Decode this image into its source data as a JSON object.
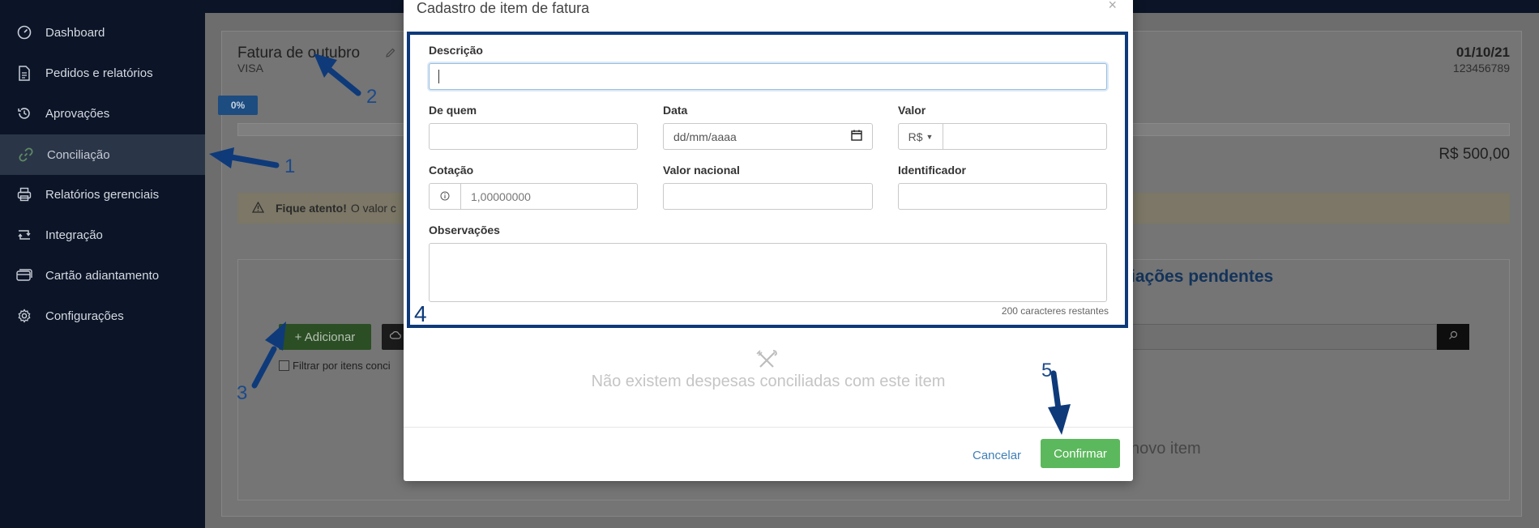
{
  "sidebar": {
    "items": [
      {
        "label": "Dashboard",
        "icon": "dashboard-icon"
      },
      {
        "label": "Pedidos e relatórios",
        "icon": "document-icon"
      },
      {
        "label": "Aprovações",
        "icon": "history-icon"
      },
      {
        "label": "Conciliação",
        "icon": "link-icon",
        "active": true
      },
      {
        "label": "Relatórios gerenciais",
        "icon": "printer-icon"
      },
      {
        "label": "Integração",
        "icon": "sync-icon"
      },
      {
        "label": "Cartão adiantamento",
        "icon": "card-icon"
      },
      {
        "label": "Configurações",
        "icon": "gear-icon"
      }
    ]
  },
  "invoice": {
    "title": "Fatura de outubro",
    "subtitle": "VISA",
    "date": "01/10/21",
    "number": "123456789",
    "progress_label": "0%",
    "progress": 0,
    "amount": "R$ 500,00",
    "warning_bold": "Fique atento!",
    "warning_text": "O valor c"
  },
  "panel": {
    "add_label": "+ Adicionar",
    "filter_label": "Filtrar por itens conci",
    "pending_title": "iações pendentes",
    "novo_item": "novo item"
  },
  "modal": {
    "title": "Cadastro de item de fatura",
    "close": "×",
    "descricao_label": "Descrição",
    "descricao_value": "",
    "de_quem_label": "De quem",
    "data_label": "Data",
    "data_placeholder": "dd/mm/aaaa",
    "valor_label": "Valor",
    "currency": "R$",
    "cotacao_label": "Cotação",
    "cotacao_value": "1,00000000",
    "valor_nacional_label": "Valor nacional",
    "identificador_label": "Identificador",
    "observacoes_label": "Observações",
    "chars_remaining": "200 caracteres restantes",
    "empty_text": "Não existem despesas conciliadas com este item",
    "cancel_label": "Cancelar",
    "confirm_label": "Confirmar"
  },
  "annotations": [
    "1",
    "2",
    "3",
    "4",
    "5"
  ],
  "colors": {
    "accent_green": "#5cb85c",
    "annotation_blue": "#0e3a7a",
    "sidebar_bg": "#0b1527"
  }
}
